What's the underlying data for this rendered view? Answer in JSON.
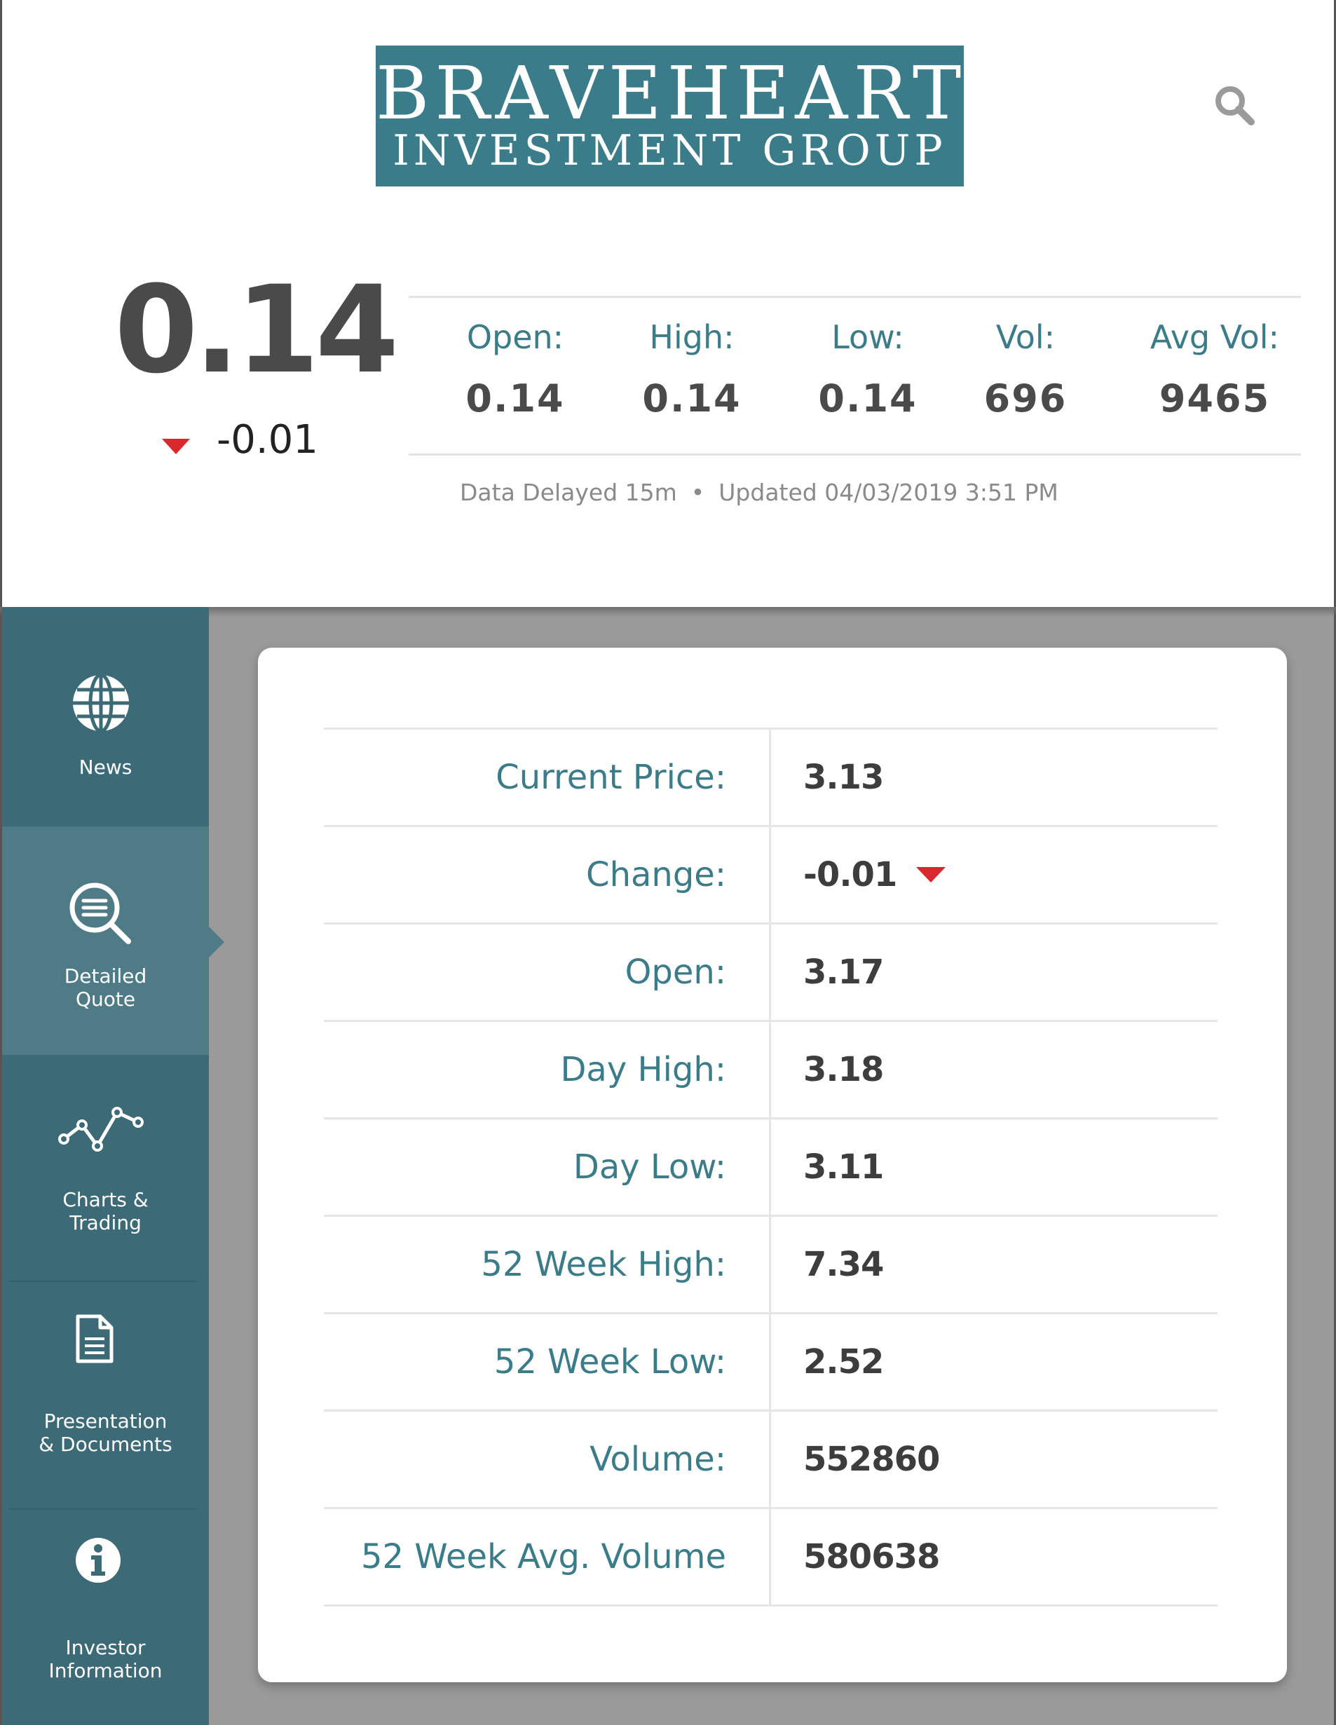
{
  "brand": {
    "line1": "BRAVEHEART",
    "line2": "INVESTMENT GROUP",
    "color": "#3a7c89"
  },
  "header": {
    "search_icon": "search-icon",
    "last_price": "0.14",
    "change": "-0.01",
    "change_direction": "down",
    "stats": [
      {
        "label": "Open:",
        "value": "0.14"
      },
      {
        "label": "High:",
        "value": "0.14"
      },
      {
        "label": "Low:",
        "value": "0.14"
      },
      {
        "label": "Vol:",
        "value": "696"
      },
      {
        "label": "Avg Vol:",
        "value": "9465"
      }
    ],
    "delay_note": "Data Delayed 15m",
    "separator": "•",
    "updated": "Updated 04/03/2019 3:51 PM"
  },
  "sidebar": {
    "items": [
      {
        "label": "News",
        "icon": "globe-icon",
        "active": false
      },
      {
        "label": "Detailed\nQuote",
        "icon": "detailed-quote-icon",
        "active": true
      },
      {
        "label": "Charts &\nTrading",
        "icon": "line-chart-icon",
        "active": false
      },
      {
        "label": "Presentation\n& Documents",
        "icon": "document-icon",
        "active": false
      },
      {
        "label": "Investor\nInformation",
        "icon": "info-icon",
        "active": false
      }
    ]
  },
  "quote": {
    "rows": [
      {
        "label": "Current Price:",
        "value": "3.13"
      },
      {
        "label": "Change:",
        "value": "-0.01"
      },
      {
        "label": "Open:",
        "value": "3.17"
      },
      {
        "label": "Day High:",
        "value": "3.18"
      },
      {
        "label": "Day Low:",
        "value": "3.11"
      },
      {
        "label": "52 Week High:",
        "value": "7.34"
      },
      {
        "label": "52 Week Low:",
        "value": "2.52"
      },
      {
        "label": "Volume:",
        "value": "552860"
      },
      {
        "label": "52 Week Avg. Volume",
        "value": "580638"
      }
    ]
  },
  "colors": {
    "accent": "#3a7c89",
    "sidebar": "#3c6a77",
    "sidebar_active": "#4e7b86",
    "down": "#d8282d"
  }
}
